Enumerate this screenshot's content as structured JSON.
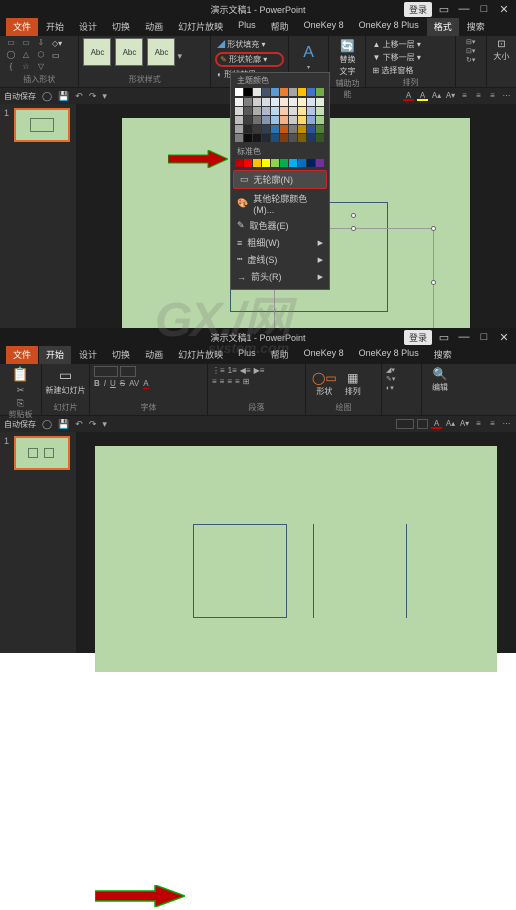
{
  "title": "演示文稿1 - PowerPoint",
  "login": "登录",
  "tabs": {
    "file": "文件",
    "home": "开始",
    "insert": "设计",
    "trans": "切换",
    "anim": "动画",
    "slideshow": "幻灯片放映",
    "plus": "Plus",
    "help": "帮助",
    "ok8": "OneKey 8",
    "ok8p": "OneKey 8 Plus",
    "format": "格式",
    "search": "搜索"
  },
  "ribbon": {
    "insert_shapes": "插入形状",
    "shape_styles": "形状样式",
    "abc": "Abc",
    "shape_fill": "形状填充",
    "shape_outline": "形状轮廓",
    "shape_effects": "形状效果",
    "edit_shape": "编辑形状",
    "replace": "替换",
    "textbox": "文字",
    "bring_fwd": "上移一层",
    "send_back": "下移一层",
    "selection": "选择窗格",
    "arrange": "排列",
    "size": "大小",
    "aux": "辅助功能",
    "clipboard": "剪贴板",
    "slides": "幻灯片",
    "font": "字体",
    "paragraph": "段落",
    "new_slide": "新建幻灯片",
    "shapes": "形状",
    "arrange2": "排列",
    "drawing": "绘图",
    "editing": "编辑"
  },
  "qat_label": "自动保存",
  "thumb_num": "1",
  "picker": {
    "theme": "主题颜色",
    "standard": "标准色",
    "no_outline": "无轮廓(N)",
    "more_outline": "其他轮廓颜色(M)...",
    "eyedropper": "取色器(E)",
    "weight": "粗细(W)",
    "dashes": "虚线(S)",
    "arrows": "箭头(R)"
  },
  "watermark": "GX./网",
  "watermark_sub": "system.com",
  "colors": {
    "theme_row1": [
      "#ffffff",
      "#000000",
      "#e7e6e6",
      "#44546a",
      "#5b9bd5",
      "#ed7d31",
      "#a5a5a5",
      "#ffc000",
      "#4472c4",
      "#70ad47"
    ],
    "theme_shades": [
      [
        "#f2f2f2",
        "#7f7f7f",
        "#d0cece",
        "#d6dce4",
        "#deebf6",
        "#fbe5d5",
        "#ededed",
        "#fff2cc",
        "#d9e2f3",
        "#e2efd9"
      ],
      [
        "#d8d8d8",
        "#595959",
        "#aeabab",
        "#adb9ca",
        "#bdd7ee",
        "#f7cbac",
        "#dbdbdb",
        "#fee599",
        "#b4c6e7",
        "#c5e0b3"
      ],
      [
        "#bfbfbf",
        "#3f3f3f",
        "#757070",
        "#8496b0",
        "#9cc3e5",
        "#f4b183",
        "#c9c9c9",
        "#ffd965",
        "#8eaadb",
        "#a8d08d"
      ],
      [
        "#a5a5a5",
        "#262626",
        "#3a3838",
        "#323f4f",
        "#2e75b5",
        "#c55a11",
        "#7b7b7b",
        "#bf9000",
        "#2f5496",
        "#538135"
      ],
      [
        "#7f7f7f",
        "#0c0c0c",
        "#171616",
        "#222a35",
        "#1e4e79",
        "#833c0b",
        "#525252",
        "#7f6000",
        "#1f3864",
        "#375623"
      ]
    ],
    "standard": [
      "#c00000",
      "#ff0000",
      "#ffc000",
      "#ffff00",
      "#92d050",
      "#00b050",
      "#00b0f0",
      "#0070c0",
      "#002060",
      "#7030a0"
    ]
  },
  "chart_data": null
}
